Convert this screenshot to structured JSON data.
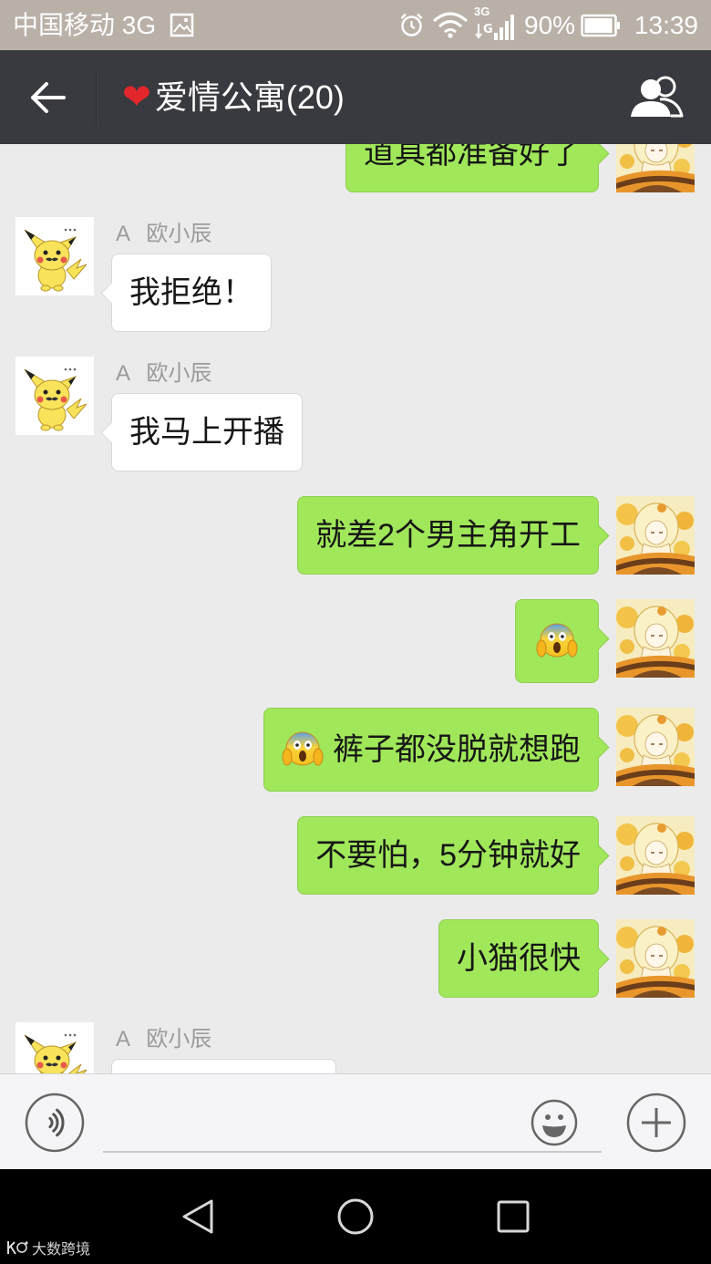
{
  "status_bar": {
    "carrier": "中国移动 3G",
    "image_icon": "image-icon",
    "alarm_icon": "alarm-icon",
    "wifi_icon": "wifi-icon",
    "signal_icon": "signal-icon",
    "network_label": "3G",
    "battery_icon": "battery-icon",
    "battery": "90%",
    "time": "13:39"
  },
  "header": {
    "back_icon": "arrow-left-icon",
    "heart": "❤",
    "title": "爱情公寓(20)",
    "members_icon": "people-icon"
  },
  "messages": [
    {
      "side": "right",
      "avatar": "anime-girl-avatar",
      "text": "道具都准备好了"
    },
    {
      "side": "left",
      "avatar": "pikachu-avatar",
      "sender": "A 欧小辰",
      "text": "我拒绝！"
    },
    {
      "side": "left",
      "avatar": "pikachu-avatar",
      "sender": "A 欧小辰",
      "text": "我马上开播"
    },
    {
      "side": "right",
      "avatar": "anime-girl-avatar",
      "text": "就差2个男主角开工"
    },
    {
      "side": "right",
      "avatar": "anime-girl-avatar",
      "emoji": "screaming-face-icon"
    },
    {
      "side": "right",
      "avatar": "anime-girl-avatar",
      "emoji": "screaming-face-icon",
      "text": "裤子都没脱就想跑"
    },
    {
      "side": "right",
      "avatar": "anime-girl-avatar",
      "text": "不要怕，5分钟就好"
    },
    {
      "side": "right",
      "avatar": "anime-girl-avatar",
      "text": "小猫很快"
    },
    {
      "side": "left",
      "avatar": "pikachu-avatar",
      "sender": "A 欧小辰"
    }
  ],
  "input_bar": {
    "voice_icon": "voice-icon",
    "input_value": "",
    "emoji_icon": "smiley-icon",
    "more_icon": "plus-icon"
  },
  "nav_bar": {
    "back_icon": "nav-back-icon",
    "home_icon": "nav-home-icon",
    "recents_icon": "nav-recents-icon"
  },
  "watermark": "大数跨境",
  "colors": {
    "status_bar_bg": "#b9b0a7",
    "header_bg": "#393a3f",
    "chat_bg": "#ebebeb",
    "bubble_self": "#a0e75a",
    "bubble_other": "#ffffff",
    "heart": "#e3262c"
  }
}
